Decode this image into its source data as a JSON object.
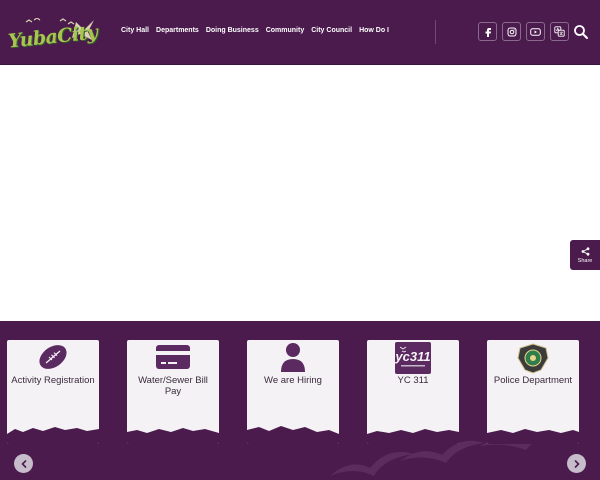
{
  "site": {
    "logo_text": "YubaCity",
    "logo_icon": "yuba-city-bird-logo"
  },
  "nav": {
    "items": [
      {
        "label": "City Hall"
      },
      {
        "label": "Departments"
      },
      {
        "label": "Doing Business"
      },
      {
        "label": "Community"
      },
      {
        "label": "City Council"
      },
      {
        "label": "How Do I"
      }
    ]
  },
  "social": {
    "icons": [
      "facebook-icon",
      "instagram-icon",
      "youtube-icon",
      "translate-icon"
    ]
  },
  "search": {
    "icon": "search-icon"
  },
  "share": {
    "label": "Share",
    "icon": "share-icon"
  },
  "quick_links": [
    {
      "label": "Activity Registration",
      "icon": "football-icon"
    },
    {
      "label": "Water/Sewer Bill Pay",
      "icon": "credit-card-icon"
    },
    {
      "label": "We are Hiring",
      "icon": "person-icon"
    },
    {
      "label": "YC 311",
      "icon": "yc311-logo-icon",
      "badge": "yc311"
    },
    {
      "label": "Police Department",
      "icon": "police-badge-icon"
    }
  ],
  "carousel": {
    "prev_icon": "chevron-left-icon",
    "next_icon": "chevron-right-icon"
  },
  "colors": {
    "brand": "#4a1b4c",
    "card": "#f5f2f6",
    "logo_green": "#a9c54f"
  }
}
